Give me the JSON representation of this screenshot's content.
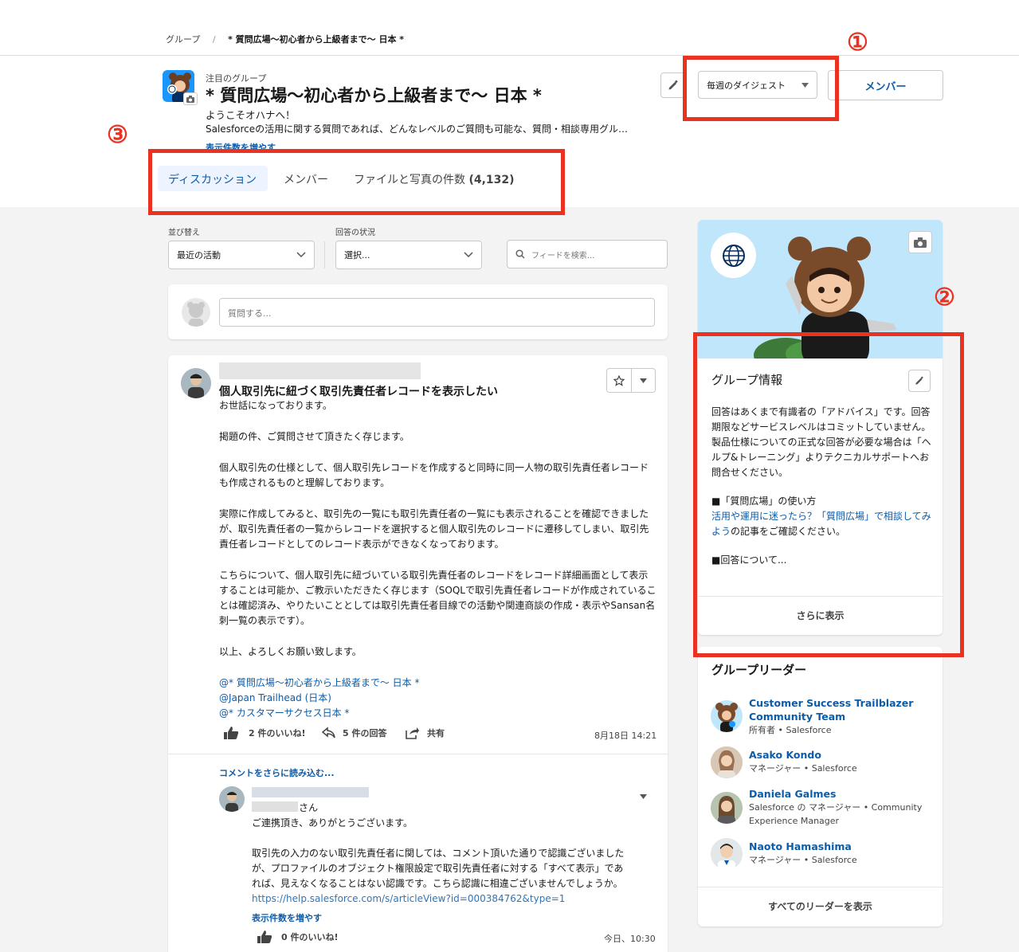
{
  "breadcrumb": {
    "root": "グループ",
    "separator": "/",
    "current": "* 質問広場～初心者から上級者まで～ 日本 *"
  },
  "header": {
    "featured_label": "注目のグループ",
    "title": "* 質問広場～初心者から上級者まで～ 日本 *",
    "welcome": "ようこそオハナへ！",
    "description": "Salesforceの活用に関する質問であれば、どんなレベルのご質問も可能な、質問・相談専用グル…",
    "show_more": "表示件数を増やす",
    "digest_select": "毎週のダイジェスト",
    "member_button": "メンバー"
  },
  "tabs": [
    {
      "label": "ディスカッション",
      "active": true
    },
    {
      "label": "メンバー",
      "active": false
    },
    {
      "label": "ファイルと写真の件数",
      "count": "(4,132)",
      "active": false
    }
  ],
  "annotations": {
    "one": "①",
    "two": "②",
    "three": "③"
  },
  "filters": {
    "sort_label": "並び替え",
    "sort_value": "最近の活動",
    "status_label": "回答の状況",
    "status_value": "選択...",
    "search_placeholder": "フィードを検索..."
  },
  "composer": {
    "placeholder": "質問する..."
  },
  "post": {
    "title": "個人取引先に紐づく取引先責任者レコードを表示したい",
    "paragraphs": [
      "お世話になっております。",
      "掲題の件、ご質問させて頂きたく存じます。",
      "個人取引先の仕様として、個人取引先レコードを作成すると同時に同一人物の取引先責任者レコードも作成されるものと理解しております。",
      "実際に作成してみると、取引先の一覧にも取引先責任者の一覧にも表示されることを確認できましたが、取引先責任者の一覧からレコードを選択すると個人取引先のレコードに遷移してしまい、取引先責任者レコードとしてのレコード表示ができなくなっております。",
      "こちらについて、個人取引先に紐づいている取引先責任者のレコードをレコード詳細画面として表示することは可能か、ご教示いただきたく存じます（SOQLで取引先責任者レコードが作成されていることは確認済み、やりたいこととしては取引先責任者目線での活動や関連商談の作成・表示やSansan名刺一覧の表示です）。",
      "以上、よろしくお願い致します。"
    ],
    "mentions": [
      "@* 質問広場～初心者から上級者まで～ 日本 *",
      "@Japan Trailhead (日本)",
      "@* カスタマーサクセス日本 *"
    ],
    "likes": "2 件のいいね!",
    "answers": "5 件の回答",
    "share": "共有",
    "timestamp": "8月18日 14:21"
  },
  "comment": {
    "load_more": "コメントをさらに読み込む...",
    "salutation_suffix": "さん",
    "paragraphs": [
      "ご連携頂き、ありがとうございます。",
      "取引先の入力のない取引先責任者に関しては、コメント頂いた通りで認識ございましたが、プロファイルのオブジェクト権限設定で取引先責任者に対する「すべて表示」であれば、見えなくなることはない認識です。こちら認識に相違ございませんでしょうか。"
    ],
    "link": "https://help.salesforce.com/s/articleView?id=000384762&type=1",
    "show_more": "表示件数を増やす",
    "likes": "0 件のいいね!",
    "timestamp": "今日、10:30"
  },
  "group_info": {
    "title": "グループ情報",
    "line1": "回答はあくまで有識者の「アドバイス」です。回答期限などサービスレベルはコミットしていません。",
    "line2": "製品仕様についての正式な回答が必要な場合は「ヘルプ&トレーニング」よりテクニカルサポートへお問合せください。",
    "usage_heading": "■「質問広場」の使い方",
    "usage_link": "活用や運用に迷ったら？「質問広場」で相談してみよう",
    "usage_suffix": "の記事をご確認ください。",
    "answer_heading": "■回答について...",
    "show_more": "さらに表示"
  },
  "leaders": {
    "title": "グループリーダー",
    "items": [
      {
        "name": "Customer Success Trailblazer Community Team",
        "role": "所有者 • Salesforce"
      },
      {
        "name": "Asako Kondo",
        "role": "マネージャー • Salesforce"
      },
      {
        "name": "Daniela Galmes",
        "role": "Salesforce の マネージャー • Community Experience Manager"
      },
      {
        "name": "Naoto Hamashima",
        "role": "マネージャー • Salesforce"
      }
    ],
    "show_all": "すべてのリーダーを表示"
  },
  "colors": {
    "accent": "#0b5cab",
    "annotation_red": "#ea3223",
    "banner_blue": "#bfe6fb"
  }
}
